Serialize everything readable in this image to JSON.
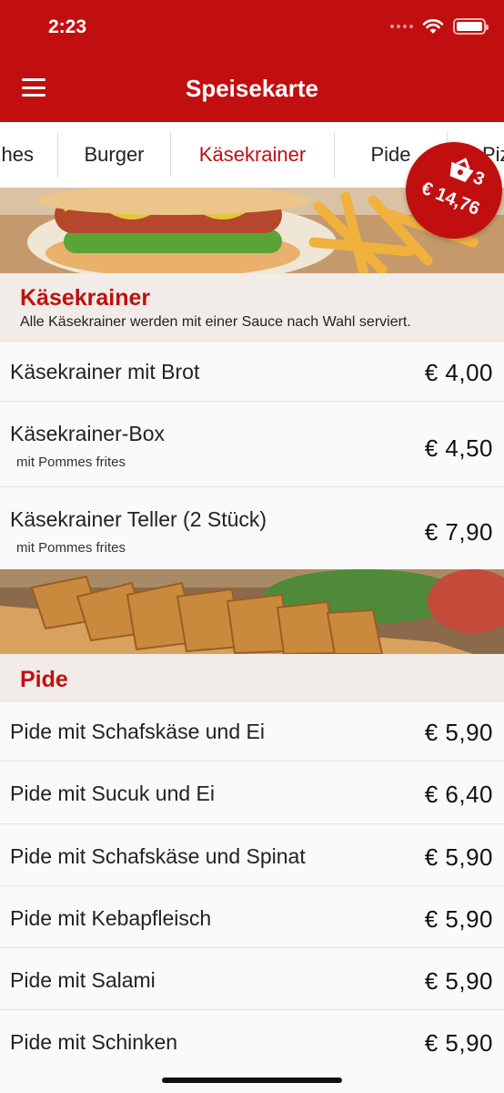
{
  "status": {
    "time": "2:23"
  },
  "header": {
    "title": "Speisekarte",
    "menu_icon": "hamburger-menu-icon"
  },
  "tabs": [
    "hes",
    "Burger",
    "Käsekrainer",
    "Pide",
    "Pizz"
  ],
  "active_tab": "Käsekrainer",
  "cart": {
    "count": "3",
    "total": "€ 14,76",
    "icon": "shopping-basket-icon"
  },
  "colors": {
    "brand": "#c10f10",
    "section_bg": "#f1ece7",
    "row_bg": "#fafafa"
  },
  "sections": [
    {
      "title": "Käsekrainer",
      "description": "Alle Käsekrainer werden mit einer Sauce nach Wahl serviert.",
      "items": [
        {
          "name": "Käsekrainer mit Brot",
          "sub": "",
          "price": "€ 4,00"
        },
        {
          "name": "Käsekrainer-Box",
          "sub": "mit Pommes frites",
          "price": "€ 4,50"
        },
        {
          "name": "Käsekrainer Teller (2 Stück)",
          "sub": "mit Pommes frites",
          "price": "€ 7,90"
        }
      ]
    },
    {
      "title": "Pide",
      "description": "",
      "items": [
        {
          "name": "Pide mit Schafskäse und Ei",
          "price": "€ 5,90"
        },
        {
          "name": "Pide mit Sucuk und Ei",
          "price": "€ 6,40"
        },
        {
          "name": "Pide mit Schafskäse und Spinat",
          "price": "€ 5,90"
        },
        {
          "name": "Pide mit Kebapfleisch",
          "price": "€ 5,90"
        },
        {
          "name": "Pide mit Salami",
          "price": "€ 5,90"
        },
        {
          "name": "Pide mit Schinken",
          "price": "€ 5,90"
        }
      ]
    }
  ]
}
